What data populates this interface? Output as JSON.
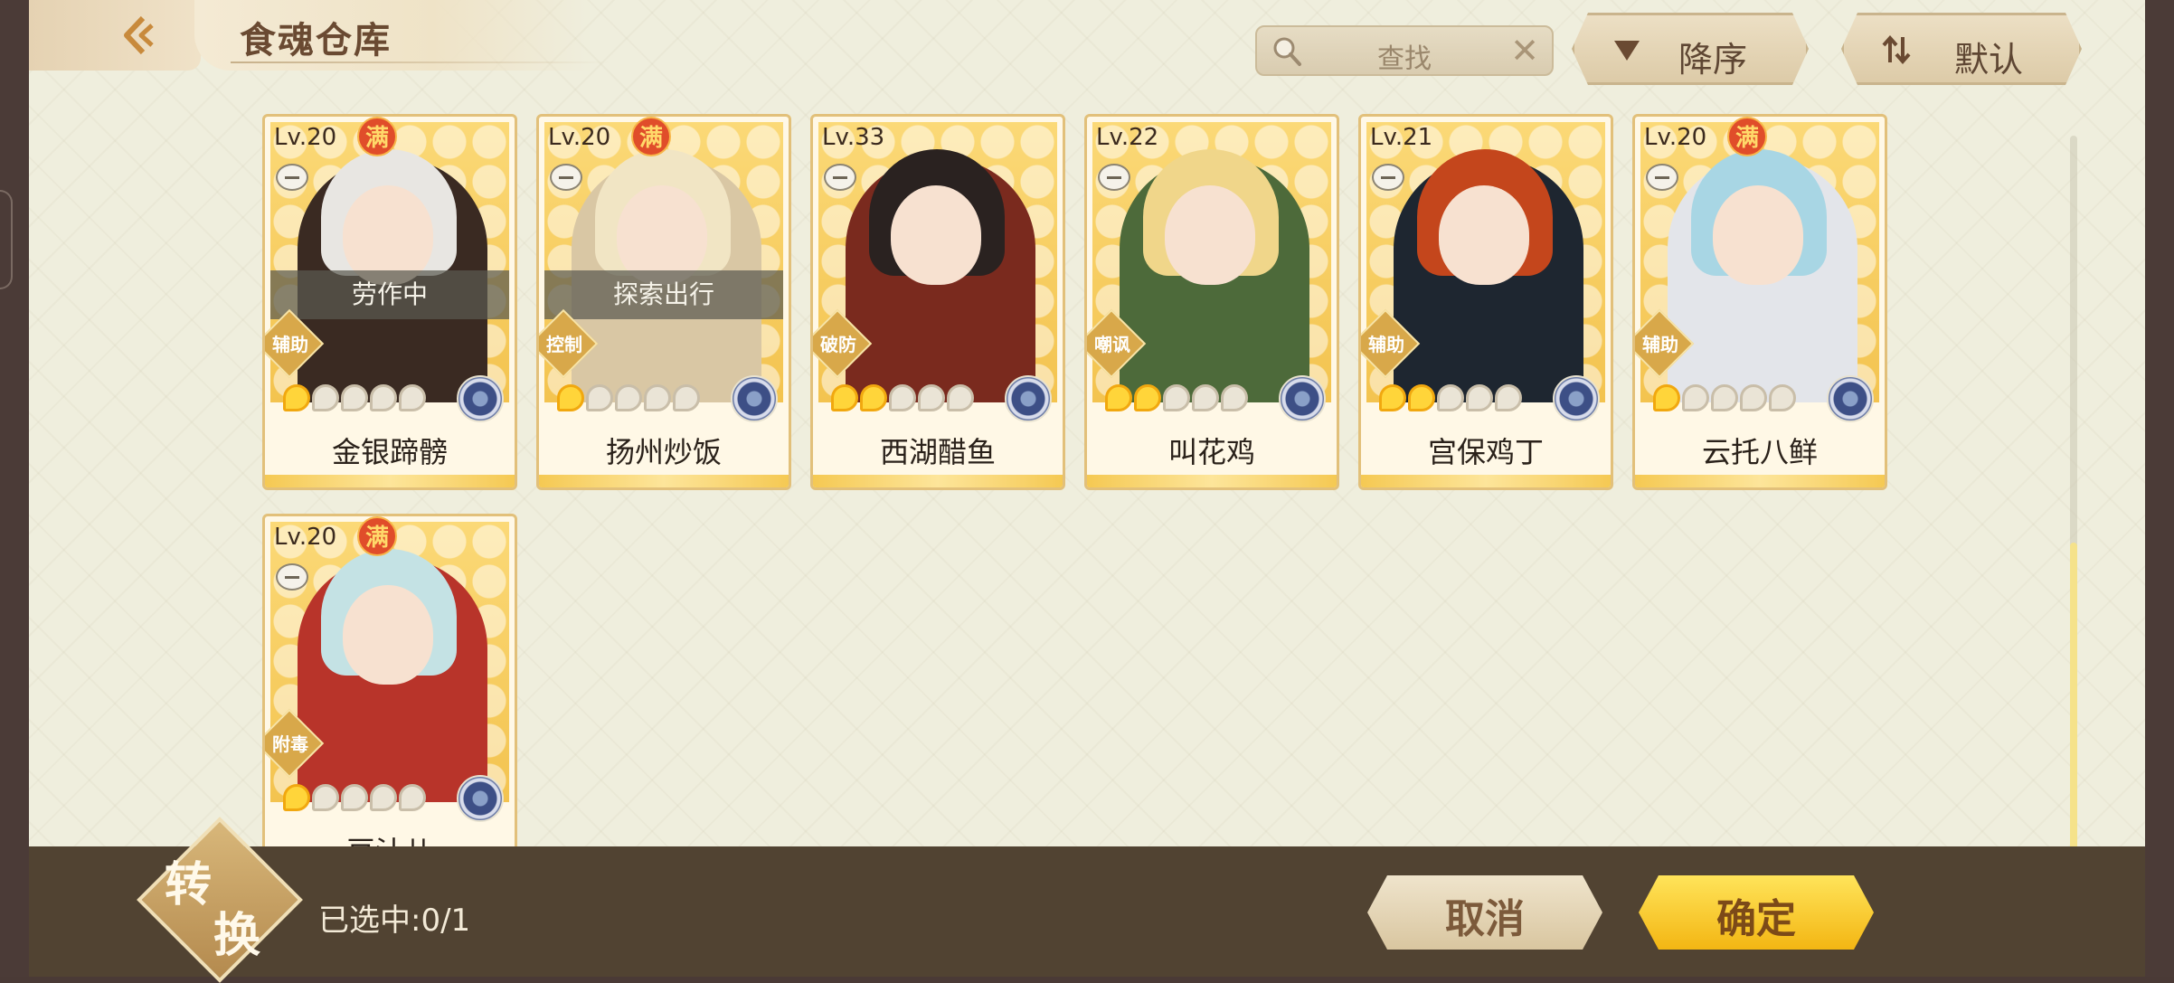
{
  "header": {
    "title": "食魂仓库",
    "back_icon": "back-chevron-icon"
  },
  "search": {
    "placeholder": "查找",
    "search_icon": "magnifier-icon",
    "clear_icon": "close-icon"
  },
  "sort": {
    "order_label": "降序",
    "order_icon": "triangle-down-icon",
    "mode_label": "默认",
    "mode_icon": "swap-arrows-icon"
  },
  "cards": [
    {
      "level": "Lv.20",
      "full": "满",
      "status": "劳作中",
      "role": "辅助",
      "stars": 1,
      "name": "金银蹄髈",
      "hair": "#e8e6e2",
      "outfit": "#3a2a22"
    },
    {
      "level": "Lv.20",
      "full": "满",
      "status": "探索出行",
      "role": "控制",
      "stars": 1,
      "name": "扬州炒饭",
      "hair": "#f1e5c4",
      "outfit": "#d9c7a4"
    },
    {
      "level": "Lv.33",
      "full": "",
      "status": "",
      "role": "破防",
      "stars": 2,
      "name": "西湖醋鱼",
      "hair": "#2a2220",
      "outfit": "#7a2a1e"
    },
    {
      "level": "Lv.22",
      "full": "",
      "status": "",
      "role": "嘲讽",
      "stars": 2,
      "name": "叫花鸡",
      "hair": "#f0d68a",
      "outfit": "#4d6a3a"
    },
    {
      "level": "Lv.21",
      "full": "",
      "status": "",
      "role": "辅助",
      "stars": 2,
      "name": "宫保鸡丁",
      "hair": "#c4461c",
      "outfit": "#1e2630"
    },
    {
      "level": "Lv.20",
      "full": "满",
      "status": "",
      "role": "辅助",
      "stars": 1,
      "name": "云托八鲜",
      "hair": "#a8d6e4",
      "outfit": "#e3e5ea"
    },
    {
      "level": "Lv.20",
      "full": "满",
      "status": "",
      "role": "附毒",
      "stars": 1,
      "name": "豆汁儿",
      "hair": "#c4e2e4",
      "outfit": "#b8342a"
    }
  ],
  "footer": {
    "convert_char1": "转",
    "convert_char2": "换",
    "selected_label": "已选中:0/1",
    "cancel_label": "取消",
    "confirm_label": "确定"
  },
  "colors": {
    "panel_bg": "#efeedd",
    "card_border": "#e2c07a",
    "confirm_gold": "#f3b613",
    "bottom_bar": "#514332"
  }
}
